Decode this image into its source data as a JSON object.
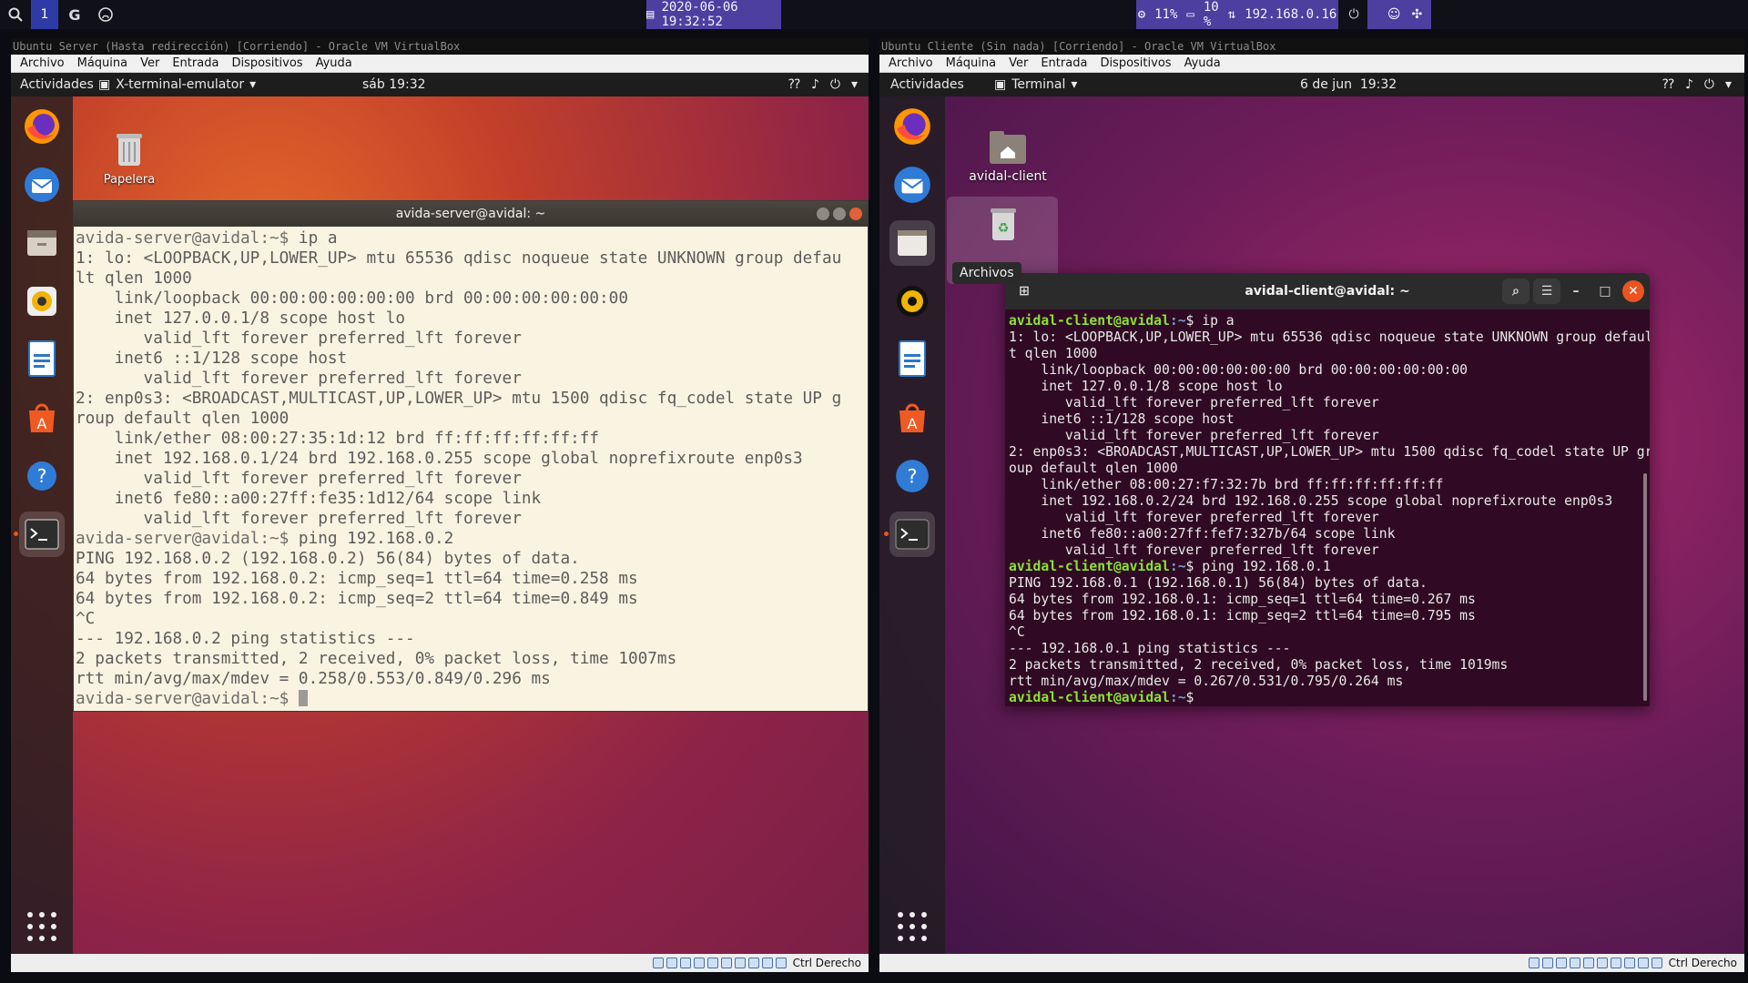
{
  "host_bar": {
    "workspace": "1",
    "datetime": "2020-06-06 19:32:52",
    "cpu": "11%",
    "disk": "10 %",
    "network": "192.168.0.16",
    "icons": [
      "search-icon",
      "google-icon",
      "github-icon",
      "calendar-icon",
      "cpu-icon",
      "disk-icon",
      "network-icon",
      "power-icon",
      "discord-icon",
      "settings-icon"
    ]
  },
  "vm_left": {
    "title": "Ubuntu Server (Hasta redirección) [Corriendo] - Oracle VM VirtualBox",
    "menu": [
      "Archivo",
      "Máquina",
      "Ver",
      "Entrada",
      "Dispositivos",
      "Ayuda"
    ],
    "panel": {
      "activities": "Actividades",
      "app": "X-terminal-emulator",
      "clock": "sáb 19:32"
    },
    "desktop_icon": "Papelera",
    "status_key": "Ctrl Derecho",
    "terminal": {
      "title": "avida-server@avidal: ~",
      "prompt": "avida-server@avidal:~$",
      "lines": [
        {
          "prompt": true,
          "text": " ip a"
        },
        {
          "text": "1: lo: <LOOPBACK,UP,LOWER_UP> mtu 65536 qdisc noqueue state UNKNOWN group defau"
        },
        {
          "text": "lt qlen 1000"
        },
        {
          "text": "    link/loopback 00:00:00:00:00:00 brd 00:00:00:00:00:00"
        },
        {
          "text": "    inet 127.0.0.1/8 scope host lo"
        },
        {
          "text": "       valid_lft forever preferred_lft forever"
        },
        {
          "text": "    inet6 ::1/128 scope host"
        },
        {
          "text": "       valid_lft forever preferred_lft forever"
        },
        {
          "text": "2: enp0s3: <BROADCAST,MULTICAST,UP,LOWER_UP> mtu 1500 qdisc fq_codel state UP g"
        },
        {
          "text": "roup default qlen 1000"
        },
        {
          "text": "    link/ether 08:00:27:35:1d:12 brd ff:ff:ff:ff:ff:ff"
        },
        {
          "text": "    inet 192.168.0.1/24 brd 192.168.0.255 scope global noprefixroute enp0s3"
        },
        {
          "text": "       valid_lft forever preferred_lft forever"
        },
        {
          "text": "    inet6 fe80::a00:27ff:fe35:1d12/64 scope link"
        },
        {
          "text": "       valid_lft forever preferred_lft forever"
        },
        {
          "prompt": true,
          "text": " ping 192.168.0.2"
        },
        {
          "text": "PING 192.168.0.2 (192.168.0.2) 56(84) bytes of data."
        },
        {
          "text": "64 bytes from 192.168.0.2: icmp_seq=1 ttl=64 time=0.258 ms"
        },
        {
          "text": "64 bytes from 192.168.0.2: icmp_seq=2 ttl=64 time=0.849 ms"
        },
        {
          "text": "^C"
        },
        {
          "text": "--- 192.168.0.2 ping statistics ---"
        },
        {
          "text": "2 packets transmitted, 2 received, 0% packet loss, time 1007ms"
        },
        {
          "text": "rtt min/avg/max/mdev = 0.258/0.553/0.849/0.296 ms"
        },
        {
          "prompt": true,
          "text": " ",
          "cursor": true
        }
      ]
    }
  },
  "vm_right": {
    "title": "Ubuntu Cliente (Sin nada) [Corriendo] - Oracle VM VirtualBox",
    "menu": [
      "Archivo",
      "Máquina",
      "Ver",
      "Entrada",
      "Dispositivos",
      "Ayuda"
    ],
    "panel": {
      "activities": "Actividades",
      "app": "Terminal",
      "clock": "6 de jun  19:32"
    },
    "desktop_icon": "avidal-client",
    "tooltip": "Archivos",
    "status_key": "Ctrl Derecho",
    "terminal": {
      "title": "avidal-client@avidal: ~",
      "user": "avidal-client@avidal",
      "cwd": ":~",
      "lines": [
        {
          "prompt": true,
          "text": "$ ip a"
        },
        {
          "text": "1: lo: <LOOPBACK,UP,LOWER_UP> mtu 65536 qdisc noqueue state UNKNOWN group defaul"
        },
        {
          "text": "t qlen 1000"
        },
        {
          "text": "    link/loopback 00:00:00:00:00:00 brd 00:00:00:00:00:00"
        },
        {
          "text": "    inet 127.0.0.1/8 scope host lo"
        },
        {
          "text": "       valid_lft forever preferred_lft forever"
        },
        {
          "text": "    inet6 ::1/128 scope host"
        },
        {
          "text": "       valid_lft forever preferred_lft forever"
        },
        {
          "text": "2: enp0s3: <BROADCAST,MULTICAST,UP,LOWER_UP> mtu 1500 qdisc fq_codel state UP gr"
        },
        {
          "text": "oup default qlen 1000"
        },
        {
          "text": "    link/ether 08:00:27:f7:32:7b brd ff:ff:ff:ff:ff:ff"
        },
        {
          "text": "    inet 192.168.0.2/24 brd 192.168.0.255 scope global noprefixroute enp0s3"
        },
        {
          "text": "       valid_lft forever preferred_lft forever"
        },
        {
          "text": "    inet6 fe80::a00:27ff:fef7:327b/64 scope link"
        },
        {
          "text": "       valid_lft forever preferred_lft forever"
        },
        {
          "prompt": true,
          "text": "$ ping 192.168.0.1"
        },
        {
          "text": "PING 192.168.0.1 (192.168.0.1) 56(84) bytes of data."
        },
        {
          "text": "64 bytes from 192.168.0.1: icmp_seq=1 ttl=64 time=0.267 ms"
        },
        {
          "text": "64 bytes from 192.168.0.1: icmp_seq=2 ttl=64 time=0.795 ms"
        },
        {
          "text": "^C"
        },
        {
          "text": "--- 192.168.0.1 ping statistics ---"
        },
        {
          "text": "2 packets transmitted, 2 received, 0% packet loss, time 1019ms"
        },
        {
          "text": "rtt min/avg/max/mdev = 0.267/0.531/0.795/0.264 ms"
        },
        {
          "prompt": true,
          "text": "$ "
        }
      ]
    }
  },
  "colors": {
    "host_accent": "#4c3fa0",
    "ubuntu_orange": "#e95420",
    "prompt_green": "#8ae234",
    "prompt_blue": "#729fcf",
    "terminal_bg_dark": "#300a24",
    "terminal_bg_light": "#fbf3e2"
  }
}
